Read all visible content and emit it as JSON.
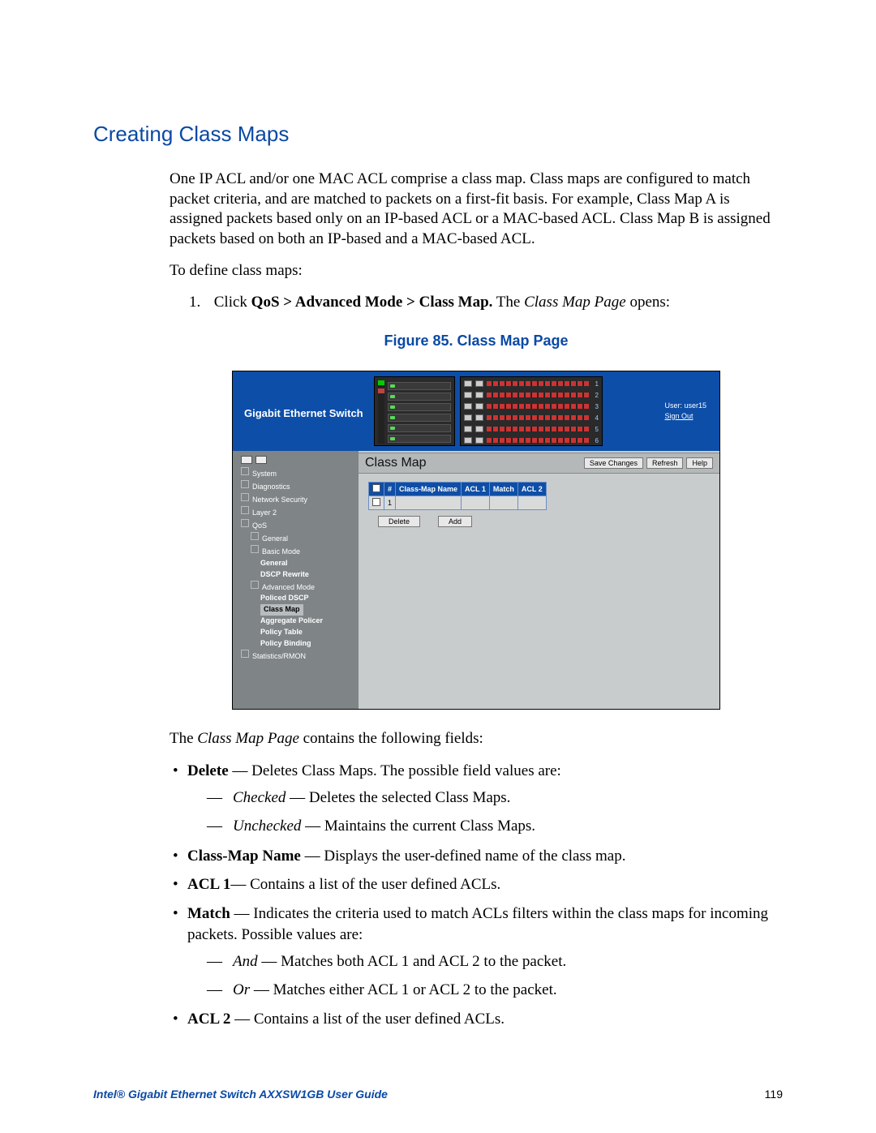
{
  "section_title": "Creating Class Maps",
  "intro": "One IP ACL and/or one MAC ACL comprise a class map. Class maps are configured to match packet criteria, and are matched to packets on a first-fit basis. For example, Class Map A is assigned packets based only on an IP-based ACL or a MAC-based ACL. Class Map B is assigned packets based on both an IP-based and a MAC-based ACL.",
  "define_line": "To define class maps:",
  "step1_num": "1.",
  "step1_prefix": "Click ",
  "step1_bold": "QoS > Advanced Mode > Class Map.",
  "step1_mid": " The ",
  "step1_ital": "Class Map Page",
  "step1_suffix": " opens:",
  "figure_caption": "Figure 85. Class Map Page",
  "shot": {
    "brand": "Gigabit Ethernet Switch",
    "user_label": "User: user15",
    "signout": "Sign Out",
    "titlebar": "Class Map",
    "btn_save": "Save Changes",
    "btn_refresh": "Refresh",
    "btn_help": "Help",
    "btn_delete": "Delete",
    "btn_add": "Add",
    "th_chk": "",
    "th_num": "#",
    "th_name": "Class-Map Name",
    "th_acl1": "ACL 1",
    "th_match": "Match",
    "th_acl2": "ACL 2",
    "row1_num": "1",
    "tree": {
      "system": "System",
      "diagnostics": "Diagnostics",
      "netsec": "Network Security",
      "layer2": "Layer 2",
      "qos": "QoS",
      "general": "General",
      "basic": "Basic Mode",
      "basic_general": "General",
      "dscp_rewrite": "DSCP Rewrite",
      "advanced": "Advanced Mode",
      "policed": "Policed DSCP",
      "classmap": "Class Map",
      "agg": "Aggregate Policer",
      "ptable": "Policy Table",
      "pbind": "Policy Binding",
      "stats": "Statistics/RMON"
    }
  },
  "contains_prefix": "The ",
  "contains_ital": "Class Map Page",
  "contains_suffix": " contains the following fields:",
  "fields": {
    "delete": {
      "term": "Delete",
      "desc": " — Deletes Class Maps. The possible field values are:"
    },
    "delete_checked": {
      "term": "Checked",
      "desc": " — Deletes the selected Class Maps."
    },
    "delete_unchecked": {
      "term": "Unchecked",
      "desc": " — Maintains the current Class Maps."
    },
    "cmname": {
      "term": "Class-Map Name",
      "desc": " — Displays the user-defined name of the class map."
    },
    "acl1": {
      "term": "ACL 1",
      "desc": "— Contains a list of the user defined ACLs."
    },
    "match": {
      "term": "Match",
      "desc": " — Indicates the criteria used to match ACLs filters within the class maps for incoming packets. Possible values are:"
    },
    "match_and": {
      "term": "And",
      "desc": " — Matches both ACL 1 and ACL 2 to the packet."
    },
    "match_or": {
      "term": "Or",
      "desc": " — Matches either ACL 1 or ACL 2 to the packet."
    },
    "acl2": {
      "term": "ACL 2",
      "desc": " — Contains a list of the user defined ACLs."
    }
  },
  "footer_doc": "Intel® Gigabit Ethernet Switch AXXSW1GB User Guide",
  "footer_page": "119"
}
